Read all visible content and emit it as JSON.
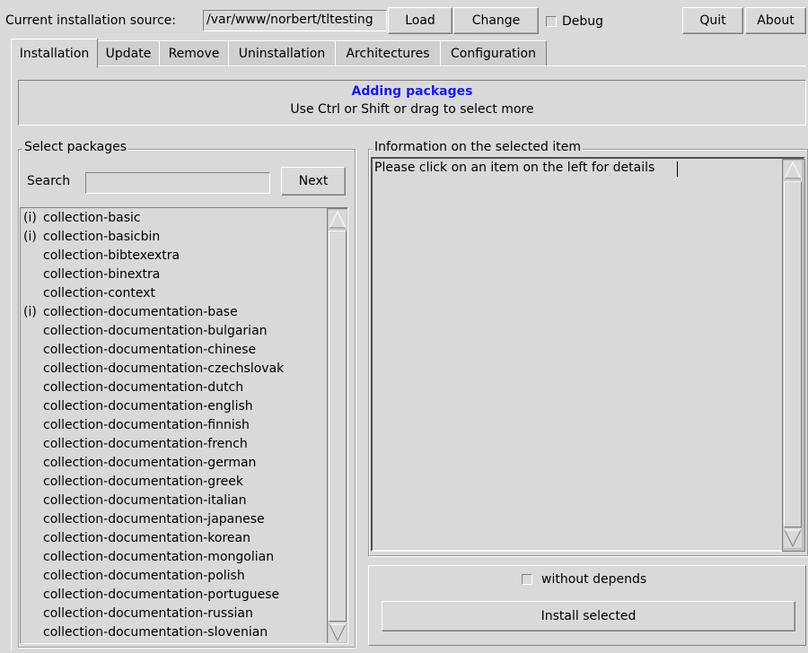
{
  "toolbar": {
    "source_label": "Current installation source:",
    "source_value": "/var/www/norbert/tltesting",
    "load_label": "Load",
    "change_label": "Change",
    "debug_label": "Debug",
    "quit_label": "Quit",
    "about_label": "About"
  },
  "tabs": [
    {
      "label": "Installation",
      "active": true
    },
    {
      "label": "Update"
    },
    {
      "label": "Remove"
    },
    {
      "label": "Uninstallation"
    },
    {
      "label": "Architectures"
    },
    {
      "label": "Configuration"
    }
  ],
  "banner": {
    "title": "Adding packages",
    "subtitle": "Use Ctrl or Shift or drag to select more",
    "title_color": "#1a1ae6"
  },
  "select_packages": {
    "title": "Select packages",
    "search_label": "Search",
    "search_value": "",
    "next_label": "Next",
    "items": [
      {
        "mark": "(i)",
        "name": "collection-basic"
      },
      {
        "mark": "(i)",
        "name": "collection-basicbin"
      },
      {
        "mark": "",
        "name": "collection-bibtexextra"
      },
      {
        "mark": "",
        "name": "collection-binextra"
      },
      {
        "mark": "",
        "name": "collection-context"
      },
      {
        "mark": "(i)",
        "name": "collection-documentation-base"
      },
      {
        "mark": "",
        "name": "collection-documentation-bulgarian"
      },
      {
        "mark": "",
        "name": "collection-documentation-chinese"
      },
      {
        "mark": "",
        "name": "collection-documentation-czechslovak"
      },
      {
        "mark": "",
        "name": "collection-documentation-dutch"
      },
      {
        "mark": "",
        "name": "collection-documentation-english"
      },
      {
        "mark": "",
        "name": "collection-documentation-finnish"
      },
      {
        "mark": "",
        "name": "collection-documentation-french"
      },
      {
        "mark": "",
        "name": "collection-documentation-german"
      },
      {
        "mark": "",
        "name": "collection-documentation-greek"
      },
      {
        "mark": "",
        "name": "collection-documentation-italian"
      },
      {
        "mark": "",
        "name": "collection-documentation-japanese"
      },
      {
        "mark": "",
        "name": "collection-documentation-korean"
      },
      {
        "mark": "",
        "name": "collection-documentation-mongolian"
      },
      {
        "mark": "",
        "name": "collection-documentation-polish"
      },
      {
        "mark": "",
        "name": "collection-documentation-portuguese"
      },
      {
        "mark": "",
        "name": "collection-documentation-russian"
      },
      {
        "mark": "",
        "name": "collection-documentation-slovenian"
      }
    ]
  },
  "info_panel": {
    "title": "Information on the selected item",
    "text": "Please click on an item on the left for details"
  },
  "actions": {
    "without_depends_label": "without depends",
    "install_label": "Install selected"
  },
  "icons": {
    "scroll_up": "scroll-up-arrow-icon",
    "scroll_down": "scroll-down-arrow-icon"
  }
}
